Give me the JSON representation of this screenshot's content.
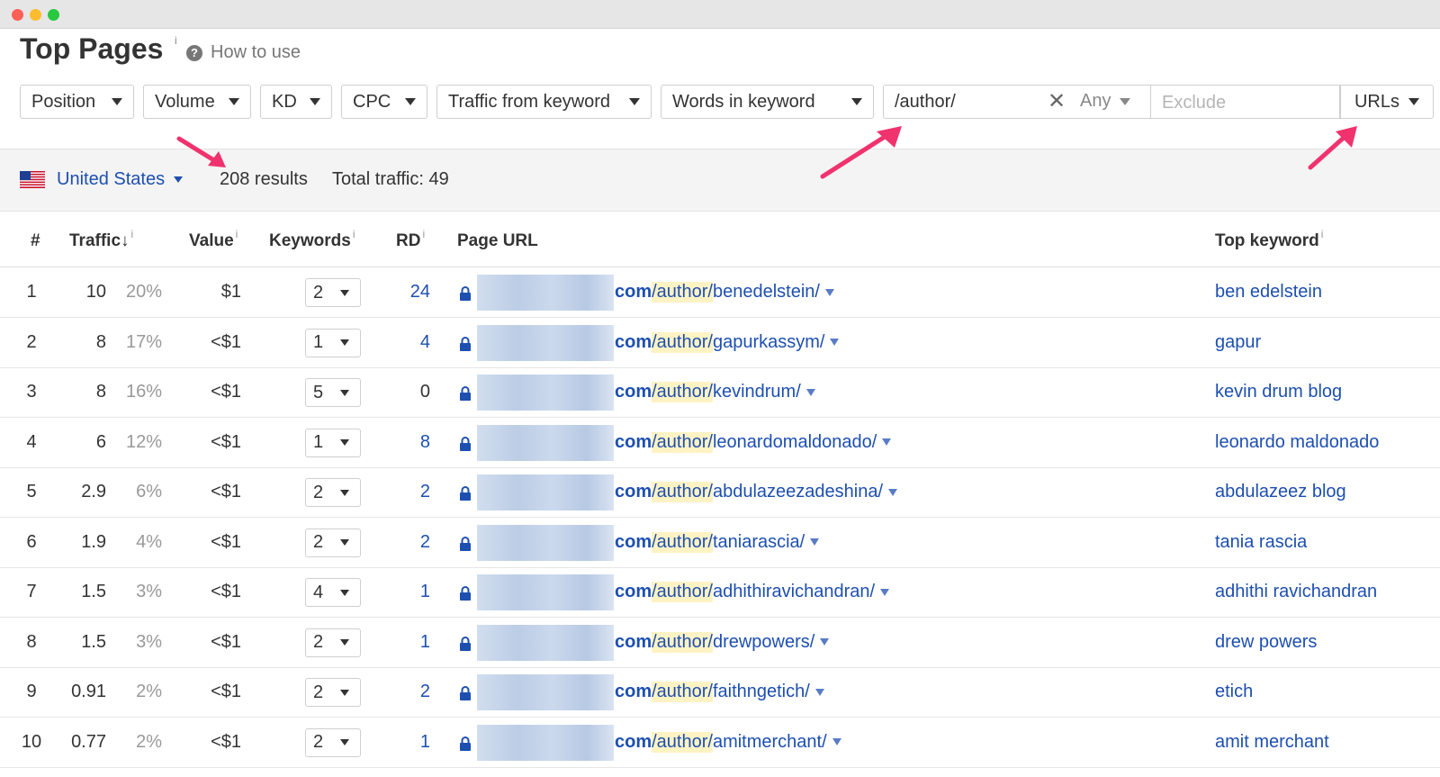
{
  "window": {
    "controls": [
      "close",
      "minimize",
      "maximize"
    ]
  },
  "header": {
    "title": "Top Pages",
    "title_info": "i",
    "help_label": "How to use",
    "help_icon": "?"
  },
  "filters": {
    "dropdowns": [
      "Position",
      "Volume",
      "KD",
      "CPC",
      "Traffic from keyword",
      "Words in keyword"
    ],
    "include_value": "/author/",
    "match_mode": "Any",
    "exclude_placeholder": "Exclude",
    "scope": "URLs"
  },
  "summary": {
    "country": "United States",
    "results": "208 results",
    "total_traffic": "Total traffic: 49"
  },
  "table": {
    "headers": {
      "num": "#",
      "traffic": "Traffic",
      "traffic_sort": "↓",
      "value": "Value",
      "keywords": "Keywords",
      "rd": "RD",
      "page_url": "Page URL",
      "top_keyword": "Top keyword",
      "info": "i"
    },
    "rows": [
      {
        "n": "1",
        "traffic": "10",
        "pct": "20%",
        "value": "$1",
        "keywords": "2",
        "rd": "24",
        "prefix": "com",
        "path_hl": "/author/",
        "path_rest": "benedelstein/",
        "top_keyword": "ben edelstein"
      },
      {
        "n": "2",
        "traffic": "8",
        "pct": "17%",
        "value": "<$1",
        "keywords": "1",
        "rd": "4",
        "prefix": "com",
        "path_hl": "/author/",
        "path_rest": "gapurkassym/",
        "top_keyword": "gapur"
      },
      {
        "n": "3",
        "traffic": "8",
        "pct": "16%",
        "value": "<$1",
        "keywords": "5",
        "rd": "0",
        "prefix": "com",
        "path_hl": "/author/",
        "path_rest": "kevindrum/",
        "top_keyword": "kevin drum blog"
      },
      {
        "n": "4",
        "traffic": "6",
        "pct": "12%",
        "value": "<$1",
        "keywords": "1",
        "rd": "8",
        "prefix": "com",
        "path_hl": "/author/",
        "path_rest": "leonardomaldonado/",
        "top_keyword": "leonardo maldonado"
      },
      {
        "n": "5",
        "traffic": "2.9",
        "pct": "6%",
        "value": "<$1",
        "keywords": "2",
        "rd": "2",
        "prefix": "com",
        "path_hl": "/author/",
        "path_rest": "abdulazeezadeshina/",
        "top_keyword": "abdulazeez blog"
      },
      {
        "n": "6",
        "traffic": "1.9",
        "pct": "4%",
        "value": "<$1",
        "keywords": "2",
        "rd": "2",
        "prefix": "com",
        "path_hl": "/author/",
        "path_rest": "taniarascia/",
        "top_keyword": "tania rascia"
      },
      {
        "n": "7",
        "traffic": "1.5",
        "pct": "3%",
        "value": "<$1",
        "keywords": "4",
        "rd": "1",
        "prefix": "com",
        "path_hl": "/author/",
        "path_rest": "adhithiravichandran/",
        "top_keyword": "adhithi ravichandran"
      },
      {
        "n": "8",
        "traffic": "1.5",
        "pct": "3%",
        "value": "<$1",
        "keywords": "2",
        "rd": "1",
        "prefix": "com",
        "path_hl": "/author/",
        "path_rest": "drewpowers/",
        "top_keyword": "drew powers"
      },
      {
        "n": "9",
        "traffic": "0.91",
        "pct": "2%",
        "value": "<$1",
        "keywords": "2",
        "rd": "2",
        "prefix": "com",
        "path_hl": "/author/",
        "path_rest": "faithngetich/",
        "top_keyword": "etich"
      },
      {
        "n": "10",
        "traffic": "0.77",
        "pct": "2%",
        "value": "<$1",
        "keywords": "2",
        "rd": "1",
        "prefix": "com",
        "path_hl": "/author/",
        "path_rest": "amitmerchant/",
        "top_keyword": "amit merchant"
      }
    ]
  },
  "colors": {
    "link": "#1d4fb0",
    "highlight": "#fff3c4",
    "annotation_arrow": "#f0326e"
  },
  "icons": {
    "help": "question-circle-icon",
    "clear": "close-icon",
    "lock": "lock-icon",
    "flag": "us-flag-icon",
    "caret": "caret-down-icon"
  }
}
